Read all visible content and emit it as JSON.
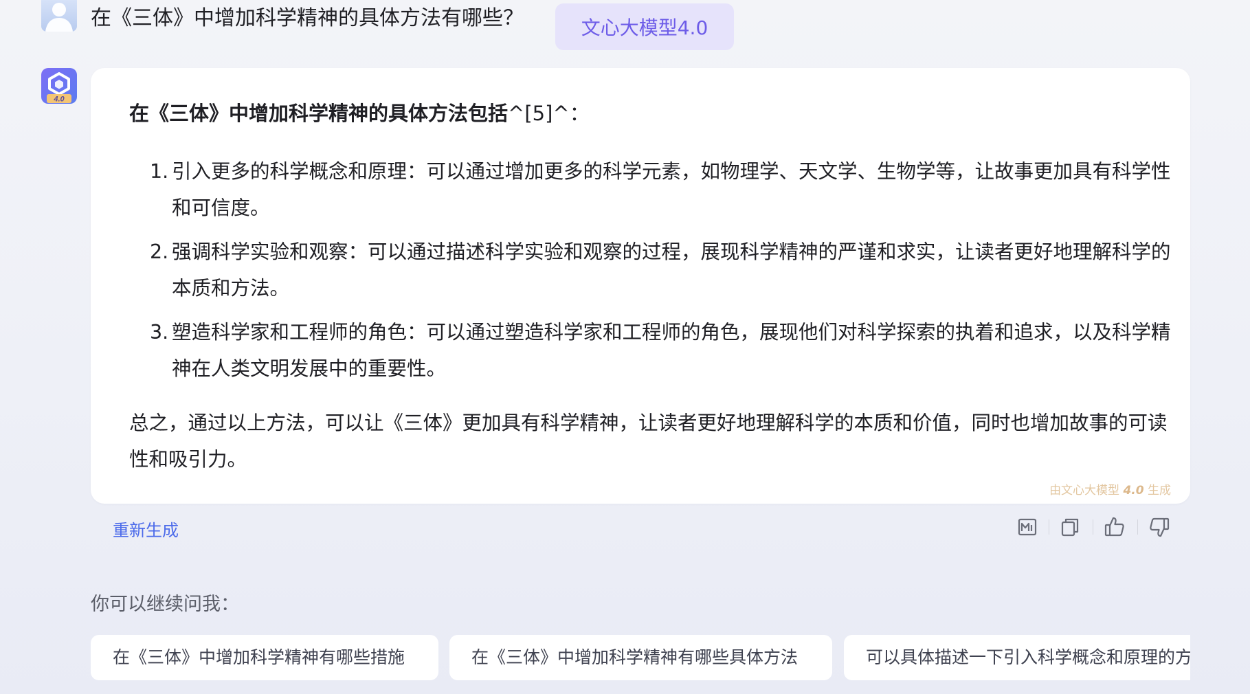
{
  "user": {
    "question": "在《三体》中增加科学精神的具体方法有哪些？"
  },
  "model_badge": "文心大模型4.0",
  "bot": {
    "avatar_version": "4.0"
  },
  "answer": {
    "title_bold": "在《三体》中增加科学精神的具体方法包括",
    "title_cite": "^[5]^：",
    "items": [
      {
        "num": "1.",
        "text": "引入更多的科学概念和原理：可以通过增加更多的科学元素，如物理学、天文学、生物学等，让故事更加具有科学性和可信度。"
      },
      {
        "num": "2.",
        "text": "强调科学实验和观察：可以通过描述科学实验和观察的过程，展现科学精神的严谨和求实，让读者更好地理解科学的本质和方法。"
      },
      {
        "num": "3.",
        "text": "塑造科学家和工程师的角色：可以通过塑造科学家和工程师的角色，展现他们对科学探索的执着和追求，以及科学精神在人类文明发展中的重要性。"
      }
    ],
    "summary": "总之，通过以上方法，可以让《三体》更加具有科学精神，让读者更好地理解科学的本质和价值，同时也增加故事的可读性和吸引力。",
    "watermark_prefix": "由文心大模型",
    "watermark_version": "4.0",
    "watermark_suffix": "生成"
  },
  "actions": {
    "regenerate": "重新生成",
    "icons": [
      "poster-icon",
      "copy-icon",
      "thumbs-up-icon",
      "thumbs-down-icon"
    ]
  },
  "suggestions": {
    "label": "你可以继续问我：",
    "items": [
      "在《三体》中增加科学精神有哪些措施",
      "在《三体》中增加科学精神有哪些具体方法",
      "可以具体描述一下引入科学概念和原理的方法吗"
    ]
  },
  "colors": {
    "accent": "#4c6bea",
    "badge_bg": "#e6e3fb",
    "badge_text": "#6d5ce8",
    "watermark": "#e3c7a1"
  }
}
